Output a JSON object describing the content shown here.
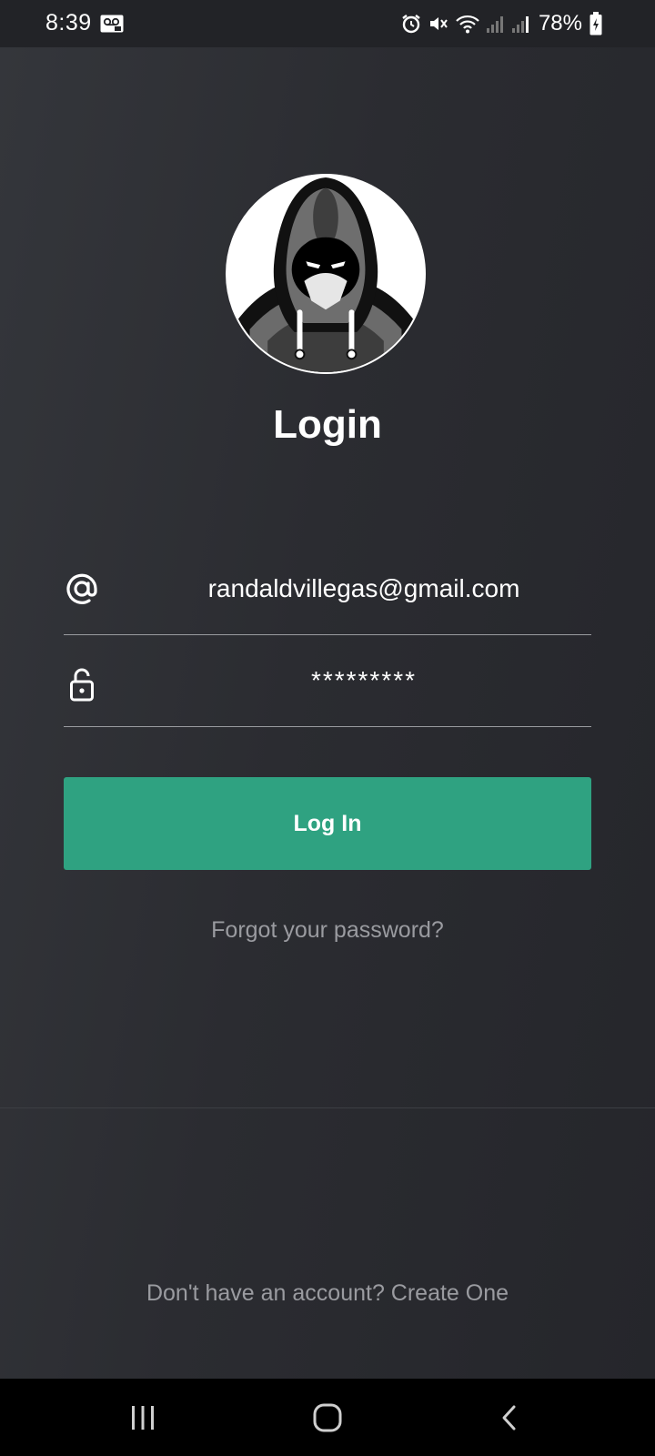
{
  "status_bar": {
    "time": "8:39",
    "battery_percent": "78%",
    "icons": [
      "voicemail-icon",
      "alarm-icon",
      "mute-icon",
      "wifi-icon",
      "signal-icon",
      "signal-icon",
      "battery-charging-icon"
    ]
  },
  "login": {
    "title": "Login",
    "email_value": "randaldvillegas@gmail.com",
    "password_value": "*********",
    "login_button_label": "Log In",
    "forgot_password_label": "Forgot your password?",
    "signup_prompt": "Don't have an account? Create One"
  },
  "colors": {
    "background": "#2a2b30",
    "accent": "#2fa281",
    "muted_text": "#9a9ba0"
  },
  "nav_bar": {
    "buttons": [
      "recents-icon",
      "home-icon",
      "back-icon"
    ]
  }
}
